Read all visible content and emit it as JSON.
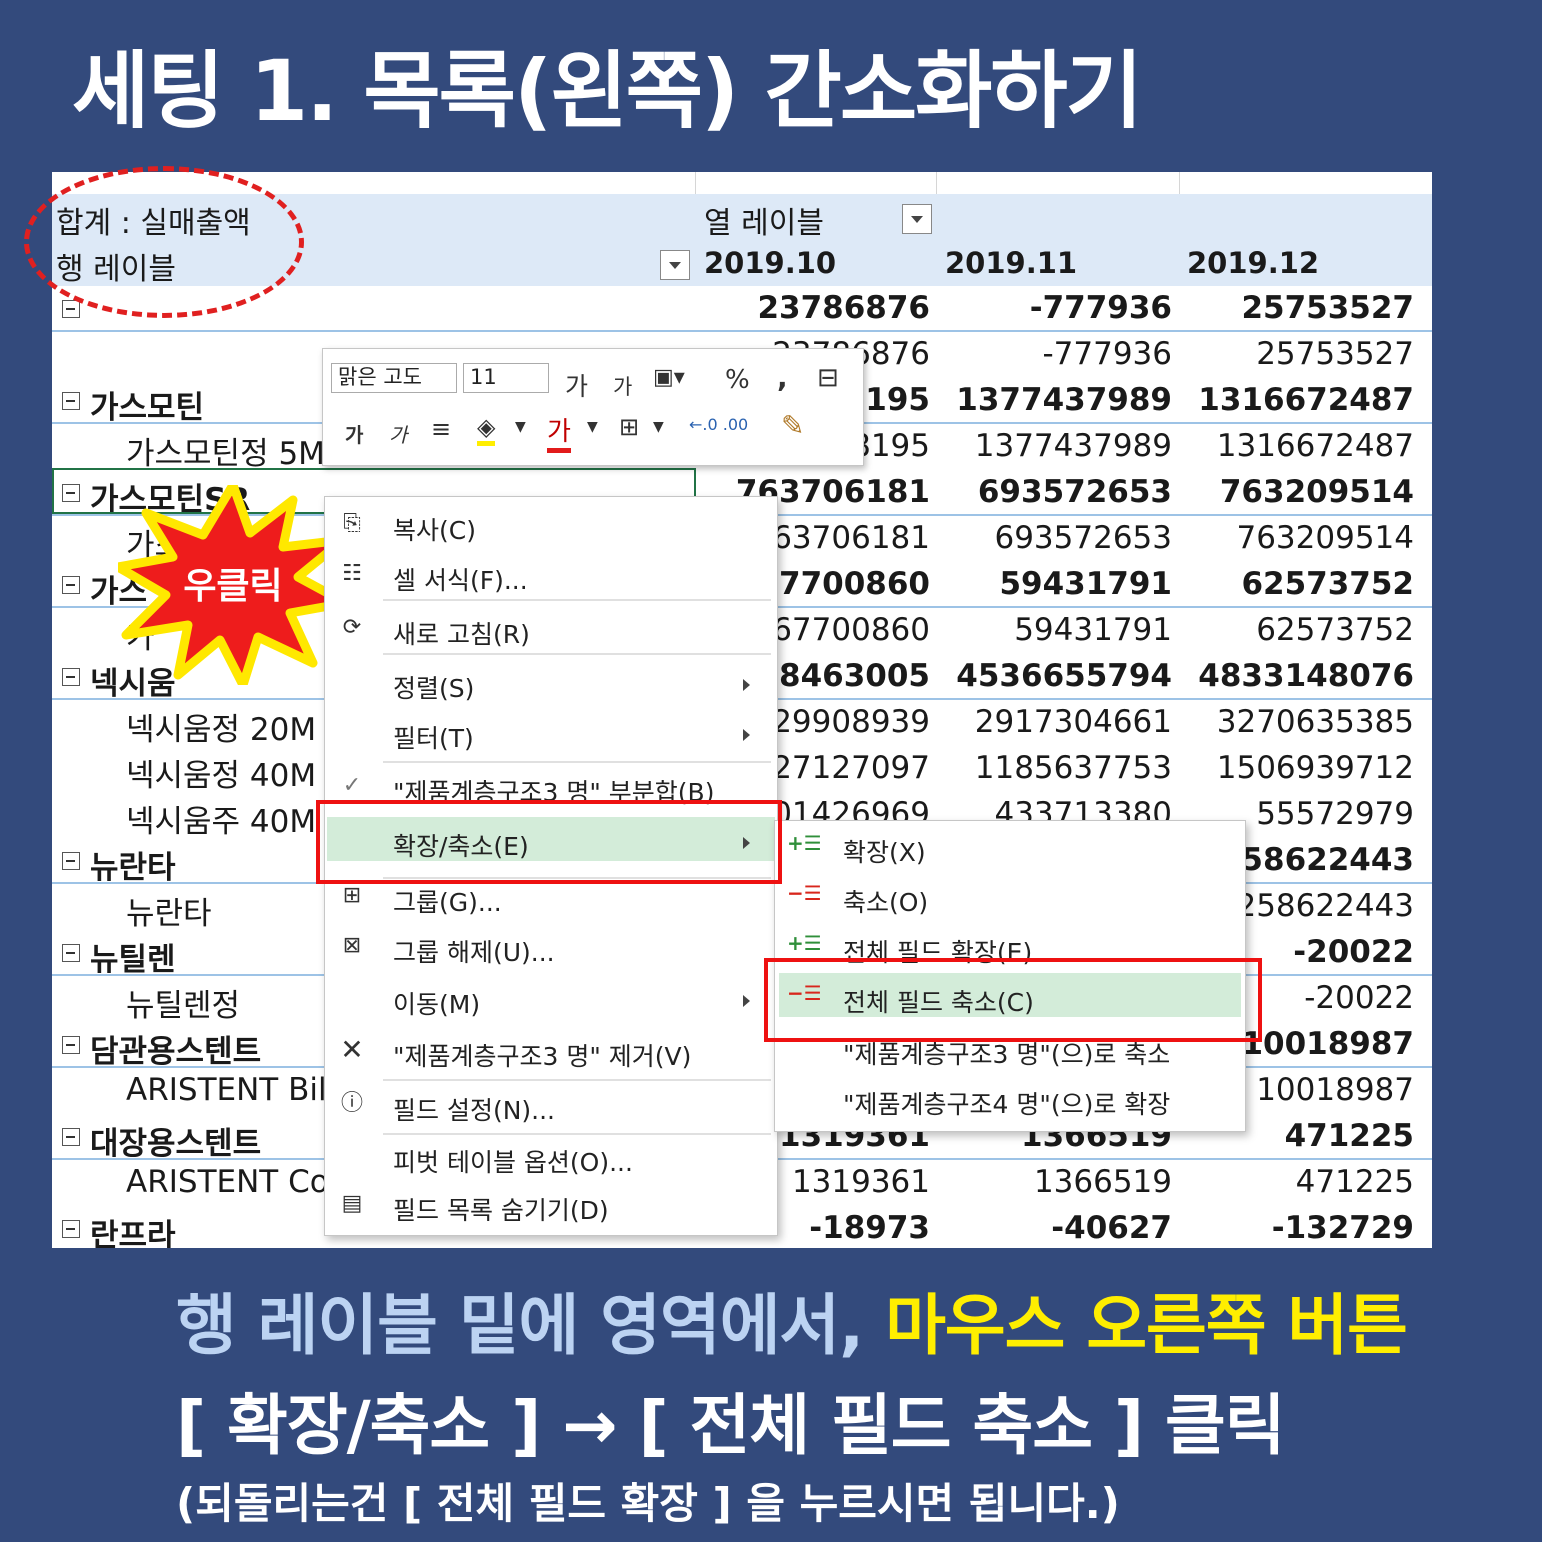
{
  "title": "세팅 1. 목록(왼쪽) 간소화하기",
  "pivot": {
    "sum_label": "합계 : 실매출액",
    "row_label": "행 레이블",
    "col_label": "열 레이블",
    "columns": [
      "2019.10",
      "2019.11",
      "2019.12"
    ],
    "rows": [
      {
        "label": "",
        "bold": true,
        "toggle": true,
        "indent": false,
        "v": [
          "23786876",
          "-777936",
          "25753527"
        ]
      },
      {
        "label": "",
        "bold": false,
        "toggle": false,
        "indent": true,
        "v": [
          "23786876",
          "-777936",
          "25753527"
        ]
      },
      {
        "label": "가스모틴",
        "bold": true,
        "toggle": true,
        "indent": false,
        "v": [
          "3195",
          "1377437989",
          "1316672487"
        ]
      },
      {
        "label": "가스모틴정 5M",
        "bold": false,
        "toggle": false,
        "indent": true,
        "v": [
          "8195",
          "1377437989",
          "1316672487"
        ]
      },
      {
        "label": "가스모틴SR",
        "bold": true,
        "toggle": true,
        "indent": false,
        "v": [
          "763706181",
          "693572653",
          "763209514"
        ]
      },
      {
        "label": "가스",
        "bold": false,
        "toggle": false,
        "indent": true,
        "v": [
          "763706181",
          "693572653",
          "763209514"
        ]
      },
      {
        "label": "가스",
        "bold": true,
        "toggle": true,
        "indent": false,
        "v": [
          "67700860",
          "59431791",
          "62573752"
        ]
      },
      {
        "label": "가",
        "bold": false,
        "toggle": false,
        "indent": true,
        "v": [
          "67700860",
          "59431791",
          "62573752"
        ]
      },
      {
        "label": "넥시움",
        "bold": true,
        "toggle": true,
        "indent": false,
        "v": [
          "58463005",
          "4536655794",
          "4833148076"
        ]
      },
      {
        "label": "넥시움정 20M",
        "bold": false,
        "toggle": false,
        "indent": true,
        "v": [
          "2929908939",
          "2917304661",
          "3270635385"
        ]
      },
      {
        "label": "넥시움정 40M",
        "bold": false,
        "toggle": false,
        "indent": true,
        "v": [
          "127127097",
          "1185637753",
          "1506939712"
        ]
      },
      {
        "label": "넥시움주 40M",
        "bold": false,
        "toggle": false,
        "indent": true,
        "v": [
          "201426969",
          "433713380",
          "55572979"
        ]
      },
      {
        "label": "뉴란타",
        "bold": true,
        "toggle": true,
        "indent": false,
        "v": [
          "",
          "",
          "258622443"
        ]
      },
      {
        "label": "뉴란타",
        "bold": false,
        "toggle": false,
        "indent": true,
        "v": [
          "",
          "",
          "258622443"
        ]
      },
      {
        "label": "뉴틸렌",
        "bold": true,
        "toggle": true,
        "indent": false,
        "v": [
          "",
          "",
          "-20022"
        ]
      },
      {
        "label": "뉴틸렌정",
        "bold": false,
        "toggle": false,
        "indent": true,
        "v": [
          "",
          "",
          "-20022"
        ]
      },
      {
        "label": "담관용스텐트",
        "bold": true,
        "toggle": true,
        "indent": false,
        "v": [
          "",
          "",
          "10018987"
        ]
      },
      {
        "label": "ARISTENT Bilia",
        "bold": false,
        "toggle": false,
        "indent": true,
        "v": [
          "",
          "",
          "10018987"
        ]
      },
      {
        "label": "대장용스텐트",
        "bold": true,
        "toggle": true,
        "indent": false,
        "v": [
          "1319361",
          "1366519",
          "471225"
        ]
      },
      {
        "label": "ARISTENT Col",
        "bold": false,
        "toggle": false,
        "indent": true,
        "v": [
          "1319361",
          "1366519",
          "471225"
        ]
      },
      {
        "label": "란프라",
        "bold": true,
        "toggle": true,
        "indent": false,
        "v": [
          "-18973",
          "-40627",
          "-132729"
        ]
      }
    ]
  },
  "burst_label": "우클릭",
  "mini_toolbar": {
    "font_name": "맑은 고도",
    "font_size": "11",
    "grow": "가",
    "shrink": "가",
    "bold": "가",
    "italic": "가",
    "font_color": "가",
    "percent": "%",
    "comma": ","
  },
  "context_menu": [
    {
      "label": "복사(C)",
      "icon": "copy-icon",
      "arrow": false
    },
    {
      "label": "셀 서식(F)...",
      "icon": "format-cells-icon",
      "arrow": false
    },
    {
      "label": "새로 고침(R)",
      "icon": "refresh-icon",
      "arrow": false
    },
    {
      "label": "정렬(S)",
      "icon": "",
      "arrow": true
    },
    {
      "label": "필터(T)",
      "icon": "",
      "arrow": true
    },
    {
      "label": "\"제품계층구조3 명\" 부분합(B)",
      "icon": "check-icon",
      "arrow": false
    },
    {
      "label": "확장/축소(E)",
      "icon": "",
      "arrow": true
    },
    {
      "label": "그룹(G)...",
      "icon": "group-icon",
      "arrow": false
    },
    {
      "label": "그룹 해제(U)...",
      "icon": "ungroup-icon",
      "arrow": false
    },
    {
      "label": "이동(M)",
      "icon": "",
      "arrow": true
    },
    {
      "label": "\"제품계층구조3 명\" 제거(V)",
      "icon": "remove-x-icon",
      "arrow": false
    },
    {
      "label": "필드 설정(N)...",
      "icon": "field-settings-icon",
      "arrow": false
    },
    {
      "label": "피벗 테이블 옵션(O)...",
      "icon": "",
      "arrow": false
    },
    {
      "label": "필드 목록 숨기기(D)",
      "icon": "field-list-icon",
      "arrow": false
    }
  ],
  "submenu": [
    {
      "label": "확장(X)",
      "icon": "expand-icon"
    },
    {
      "label": "축소(O)",
      "icon": "collapse-icon"
    },
    {
      "label": "전체 필드 확장(E)",
      "icon": "expand-all-icon"
    },
    {
      "label": "전체 필드 축소(C)",
      "icon": "collapse-all-icon"
    },
    {
      "label": "\"제품계층구조3 명\"(으)로 축소",
      "icon": ""
    },
    {
      "label": "\"제품계층구조4 명\"(으)로 확장",
      "icon": ""
    }
  ],
  "caption": {
    "line1_a": "행 레이블 밑에 영역에서, ",
    "line1_b": "마우스 오른쪽 버튼",
    "line2": "[ 확장/축소 ]  → [ 전체 필드 축소 ] 클릭",
    "line3": "(되돌리는건 [ 전체 필드 확장 ] 을 누르시면 됩니다.)"
  },
  "colors": {
    "background": "#334a7c",
    "highlight_yellow": "#ffee00",
    "light_blue_text": "#bcd3f2",
    "red_marker": "#ee1111",
    "menu_highlight": "#d3ecd9"
  }
}
